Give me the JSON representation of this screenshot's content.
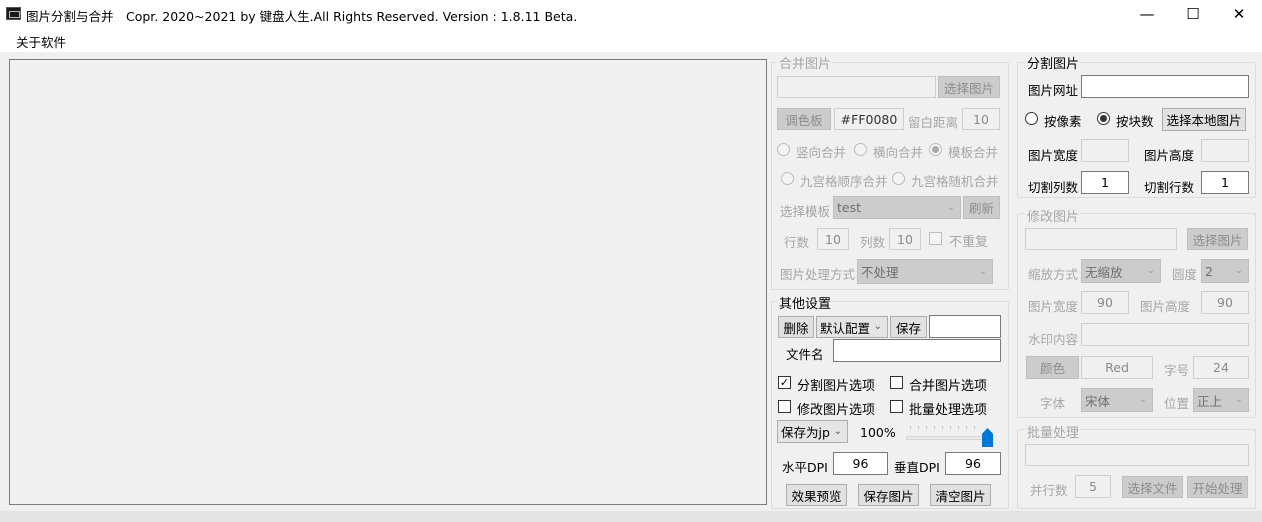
{
  "window": {
    "title": "图片分割与合并",
    "info": "Copr. 2020~2021 by 键盘人生.All Rights Reserved.  Version : 1.8.11 Beta.",
    "minimize_glyph": "—",
    "maximize_glyph": "☐",
    "close_glyph": "✕"
  },
  "menu": {
    "about": "关于软件"
  },
  "merge": {
    "title": "合并图片",
    "select_button": "选择图片",
    "palette_button": "调色板",
    "color_value": "#FF0080",
    "margin_label": "留白距离",
    "margin_value": "10",
    "radio_vertical": "竖向合并",
    "radio_horizontal": "横向合并",
    "radio_template": "模板合并",
    "radio_grid_order": "九宫格顺序合并",
    "radio_grid_random": "九宫格随机合并",
    "template_label": "选择模板",
    "template_value": "test",
    "refresh_button": "刷新",
    "rows_label": "行数",
    "rows_value": "10",
    "cols_label": "列数",
    "cols_value": "10",
    "no_repeat_label": "不重复",
    "process_label": "图片处理方式",
    "process_value": "不处理"
  },
  "other": {
    "title": "其他设置",
    "delete_button": "删除",
    "config_value": "默认配置",
    "save_button": "保存",
    "filename_label": "文件名",
    "chk_split": "分割图片选项",
    "chk_merge": "合并图片选项",
    "chk_modify": "修改图片选项",
    "chk_batch": "批量处理选项",
    "format_value": "保存为jp",
    "quality_value": "100%",
    "quality_level": 1.0,
    "hdpi_label": "水平DPI",
    "hdpi_value": "96",
    "vdpi_label": "垂直DPI",
    "vdpi_value": "96",
    "preview_button": "效果预览",
    "save_image_button": "保存图片",
    "clear_button": "清空图片"
  },
  "split": {
    "title": "分割图片",
    "url_label": "图片网址",
    "radio_pixel": "按像素",
    "radio_block": "按块数",
    "select_local_button": "选择本地图片",
    "width_label": "图片宽度",
    "height_label": "图片高度",
    "cols_label": "切割列数",
    "cols_value": "1",
    "rows_label": "切割行数",
    "rows_value": "1"
  },
  "modify": {
    "title": "修改图片",
    "select_button": "选择图片",
    "scale_label": "缩放方式",
    "scale_value": "无缩放",
    "radius_label": "圆度",
    "radius_value": "2",
    "width_label": "图片宽度",
    "width_value": "90",
    "height_label": "图片高度",
    "height_value": "90",
    "watermark_label": "水印内容",
    "color_button": "颜色",
    "color_value": "Red",
    "fontsize_label": "字号",
    "fontsize_value": "24",
    "font_label": "字体",
    "font_value": "宋体",
    "position_label": "位置",
    "position_value": "正上"
  },
  "batch": {
    "title": "批量处理",
    "threads_label": "并行数",
    "threads_value": "5",
    "select_files_button": "选择文件",
    "start_button": "开始处理"
  }
}
